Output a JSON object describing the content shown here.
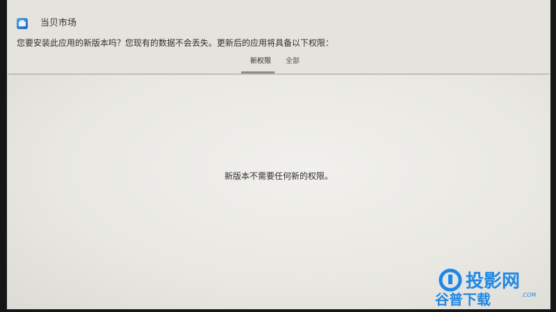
{
  "dialog": {
    "app_name": "当贝市场",
    "question": "您要安装此应用的新版本吗？您现有的数据不会丢失。更新后的应用将具备以下权限：",
    "tabs": [
      {
        "label": "新权限",
        "active": true
      },
      {
        "label": "全部",
        "active": false
      }
    ],
    "message": "新版本不需要任何新的权限。"
  },
  "watermark": {
    "line1": "投影网",
    "line2": "谷普下载",
    "domain": ".COM"
  },
  "colors": {
    "screen_bg": "#e9e8e4",
    "bezel": "#121212",
    "watermark_blue": "#1e88e5"
  }
}
